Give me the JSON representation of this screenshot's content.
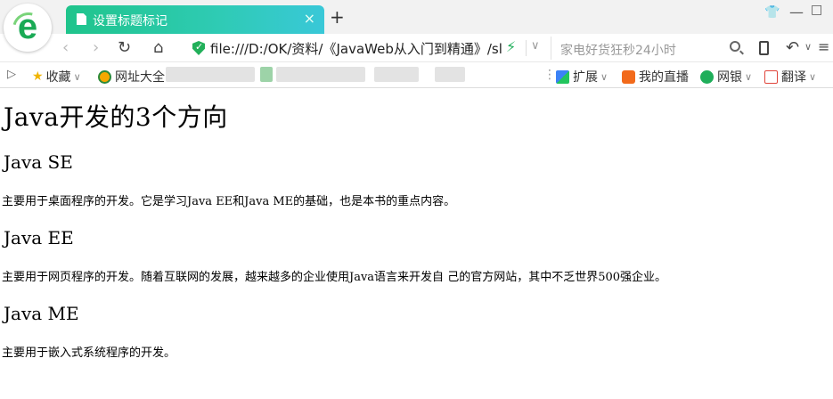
{
  "browser": {
    "logo_letter": "e",
    "tab": {
      "title": "设置标题标记",
      "close": "×"
    },
    "new_tab": "+",
    "address": {
      "url": "file:///D:/OK/资料/《JavaWeb从入门到精通》/sl",
      "search_placeholder": "家电好货狂秒24小时"
    },
    "bookmarks": {
      "favorites": "收藏",
      "sites": "网址大全",
      "extensions": "扩展",
      "live": "我的直播",
      "bank": "网银",
      "translate": "翻译"
    }
  },
  "page": {
    "title": "Java开发的3个方向",
    "sections": [
      {
        "heading": "Java SE",
        "text": "主要用于桌面程序的开发。它是学习Java EE和Java ME的基础，也是本书的重点内容。"
      },
      {
        "heading": "Java EE",
        "text": "主要用于网页程序的开发。随着互联网的发展，越来越多的企业使用Java语言来开发自 己的官方网站，其中不乏世界500强企业。"
      },
      {
        "heading": "Java ME",
        "text": "主要用于嵌入式系统程序的开发。"
      }
    ]
  },
  "colors": {
    "tab_gradient_start": "#1fc48b",
    "tab_gradient_end": "#39c8d8",
    "brand_green": "#1aaa55"
  }
}
